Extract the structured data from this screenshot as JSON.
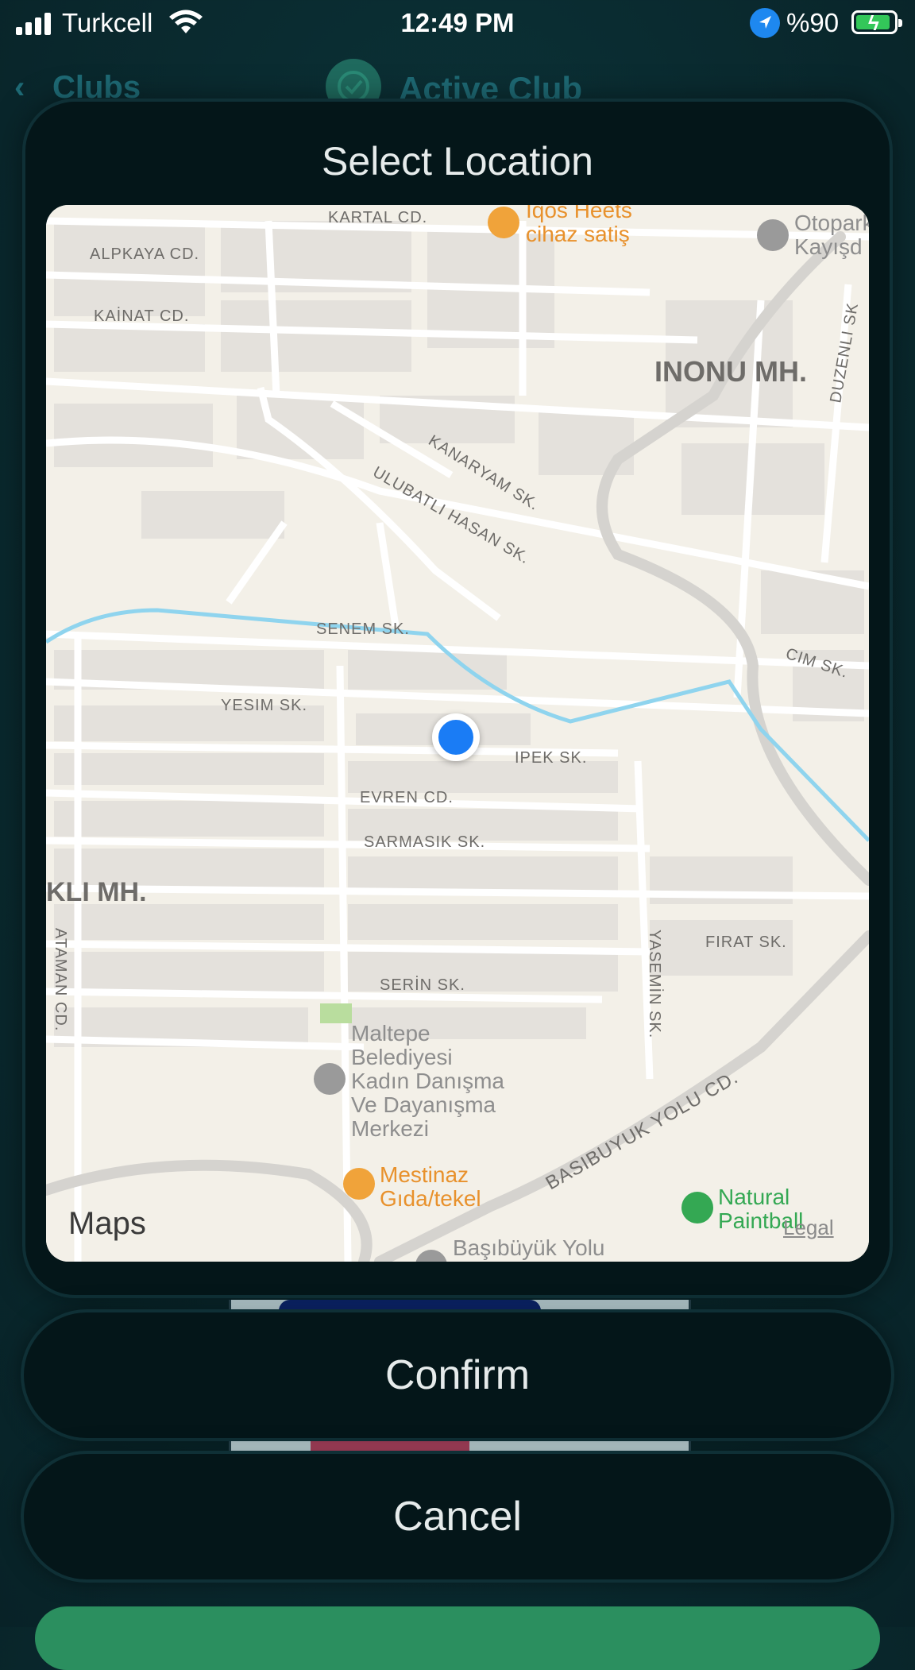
{
  "status_bar": {
    "carrier": "Turkcell",
    "time": "12:49 PM",
    "battery": "%90",
    "icons": [
      "signal-icon",
      "wifi-icon",
      "location-arrow-icon",
      "battery-charging-icon"
    ]
  },
  "header": {
    "back_label": "Clubs",
    "title": "Active Club"
  },
  "modal": {
    "title": "Select Location",
    "map": {
      "brand": "Maps",
      "legal": "Legal",
      "streets": [
        "KARTAL CD.",
        "ALPKAYA CD.",
        "KAİNAT CD.",
        "KANARYAM SK.",
        "ULUBATLI HASAN SK.",
        "SENEM SK.",
        "YESIM SK.",
        "IPEK SK.",
        "EVREN CD.",
        "SARMASIK SK.",
        "FIRAT SK.",
        "SERİN SK.",
        "YASEMİN SK.",
        "ATAMAN CD.",
        "BASIBUYUK YOLU CD.",
        "CIM SK.",
        "DUZENLI SK"
      ],
      "districts": [
        "INONU MH.",
        "KLI MH."
      ],
      "pois": [
        {
          "name": "Iqos Heets cihaz satiş",
          "color": "#e8912c"
        },
        {
          "name": "Otopark Kayışd",
          "color": "#8e8e8e"
        },
        {
          "name": "Maltepe Belediyesi Kadın Danışma Ve Dayanışma Merkezi",
          "color": "#8e8e8e"
        },
        {
          "name": "Mestinaz Gıda/tekel",
          "color": "#e8912c"
        },
        {
          "name": "Natural Paintball",
          "color": "#34a853"
        },
        {
          "name": "Başıbüyük Yolu",
          "color": "#8e8e8e"
        }
      ]
    }
  },
  "buttons": {
    "confirm": "Confirm",
    "cancel": "Cancel"
  }
}
